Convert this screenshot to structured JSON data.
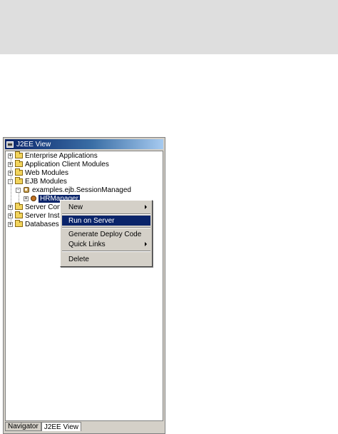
{
  "panel": {
    "title": "J2EE View",
    "tree": [
      {
        "label": "Enterprise Applications",
        "expander": "+",
        "icon": "folder-icon"
      },
      {
        "label": "Application Client Modules",
        "expander": "+",
        "icon": "folder-icon"
      },
      {
        "label": "Web Modules",
        "expander": "+",
        "icon": "folder-icon"
      },
      {
        "label": "EJB Modules",
        "expander": "-",
        "icon": "folder-icon"
      },
      {
        "label": "examples.ejb.SessionManaged",
        "expander": "-",
        "icon": "jar-icon"
      },
      {
        "label": "HRManager",
        "expander": "+",
        "icon": "bean-icon"
      },
      {
        "label": "Server Conf",
        "expander": "+",
        "icon": "folder-icon"
      },
      {
        "label": "Server Insta",
        "expander": "+",
        "icon": "folder-icon"
      },
      {
        "label": "Databases",
        "expander": "+",
        "icon": "folder-icon"
      }
    ],
    "tabs": [
      "Navigator",
      "J2EE View"
    ]
  },
  "context_menu": {
    "items": [
      "New",
      "Run on Server",
      "Generate Deploy Code",
      "Quick Links",
      "Delete"
    ]
  },
  "colors": {
    "selection": "#0a246a",
    "panel_bg": "#d4d0c8"
  }
}
